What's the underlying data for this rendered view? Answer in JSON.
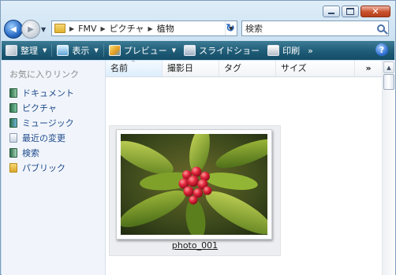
{
  "window": {
    "controls": {
      "minimize_icon": "minimize-icon",
      "maximize_icon": "maximize-icon",
      "close_icon": "close-icon",
      "close_glyph": "✕"
    }
  },
  "address_bar": {
    "back_glyph": "◀",
    "forward_glyph": "▶",
    "breadcrumbs": [
      "FMV",
      "ピクチャ",
      "植物"
    ],
    "separator_glyph": "▶",
    "dropdown_glyph": "▼",
    "refresh_glyph": "↻"
  },
  "search": {
    "placeholder": "検索"
  },
  "toolbar": {
    "organize_label": "整理",
    "views_label": "表示",
    "preview_label": "プレビュー",
    "slideshow_label": "スライドショー",
    "print_label": "印刷",
    "overflow_label": "»",
    "dropdown_glyph": "▼",
    "help_label": "?"
  },
  "sidebar": {
    "title": "お気に入りリンク",
    "items": [
      {
        "label": "ドキュメント",
        "icon": "documents-icon"
      },
      {
        "label": "ピクチャ",
        "icon": "pictures-icon"
      },
      {
        "label": "ミュージック",
        "icon": "music-icon"
      },
      {
        "label": "最近の変更",
        "icon": "recent-changes-icon"
      },
      {
        "label": "検索",
        "icon": "searches-icon"
      },
      {
        "label": "パブリック",
        "icon": "public-folder-icon"
      }
    ]
  },
  "columns": {
    "name": "名前",
    "date_taken": "撮影日",
    "tags": "タグ",
    "size": "サイズ",
    "more": "»",
    "sort_glyph": "^"
  },
  "files": [
    {
      "name": "photo_001",
      "thumbnail": "red-flower-buds-photo"
    }
  ],
  "scrollbar": {
    "up_glyph": "▲"
  }
}
